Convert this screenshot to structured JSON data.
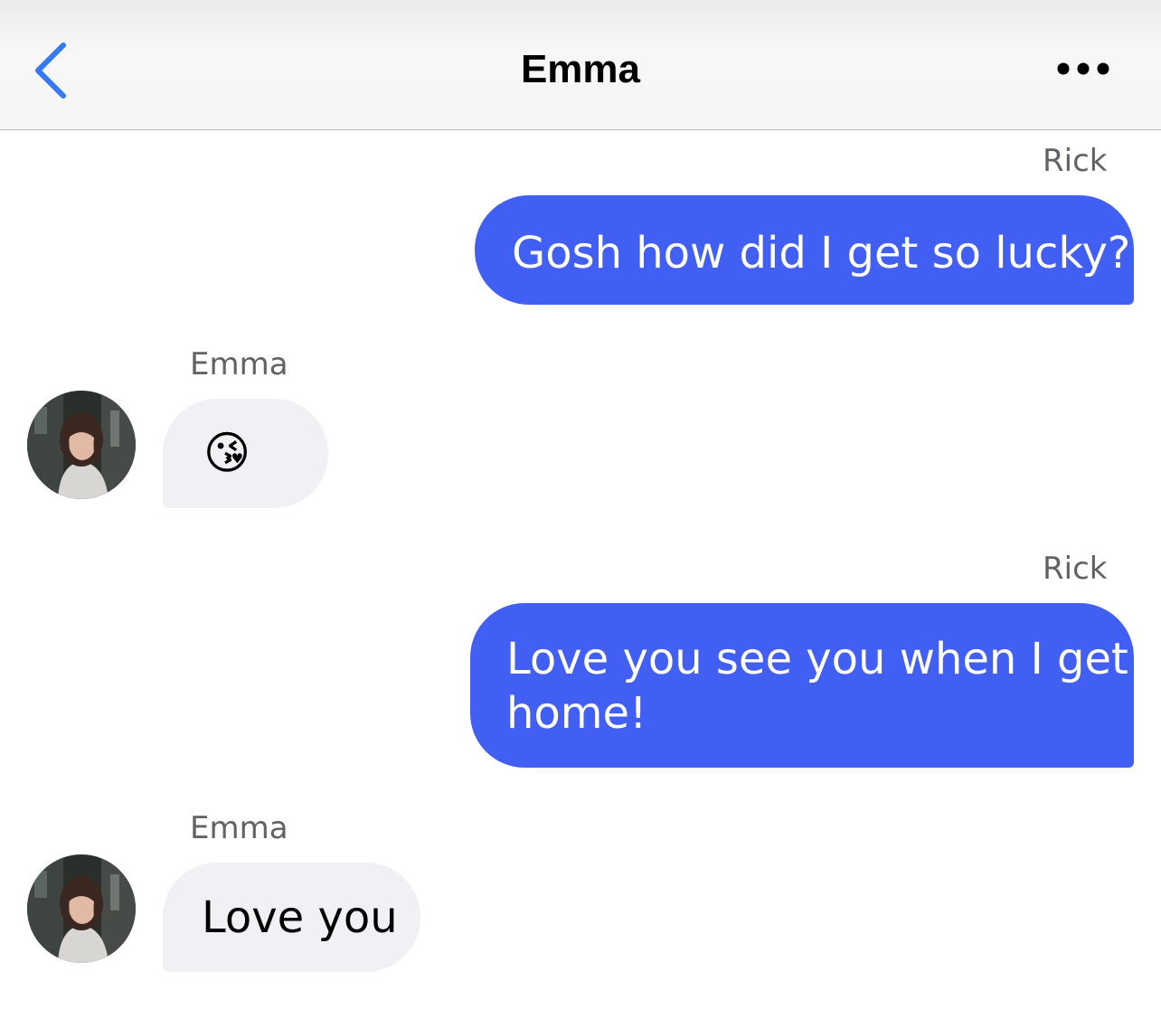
{
  "header": {
    "title": "Emma",
    "back_icon": "chevron-left-icon",
    "more_icon": "ellipsis-icon",
    "accent_color": "#3478f6"
  },
  "messages": [
    {
      "sender": "Rick",
      "text": "Gosh how did I get so lucky?",
      "direction": "outgoing"
    },
    {
      "sender": "Emma",
      "text": "😘",
      "direction": "incoming"
    },
    {
      "sender": "Rick",
      "text_line1": "Love you see you when I get",
      "text_line2": "home!",
      "direction": "outgoing"
    },
    {
      "sender": "Emma",
      "text": "Love you",
      "direction": "incoming"
    }
  ],
  "colors": {
    "outgoing_bubble": "#415ff2",
    "incoming_bubble": "#f0f0f5",
    "sender_label": "#626266"
  }
}
